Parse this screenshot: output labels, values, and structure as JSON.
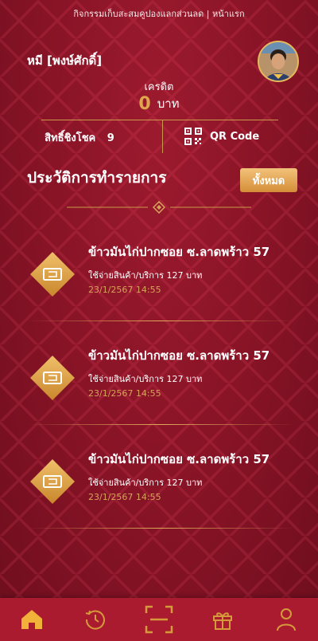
{
  "header": {
    "title": "กิจกรรมเก็บสะสมคูปองแลกส่วนลด | หน้าแรก"
  },
  "user": {
    "name": "หมี [พงษ์ศักดิ์]",
    "avatar_icon": "user-avatar-photo"
  },
  "credit": {
    "label": "เครดิต",
    "amount": "0",
    "unit": "บาท"
  },
  "chance": {
    "label": "สิทธิ์ชิงโชค",
    "value": "9"
  },
  "qr": {
    "label": "QR Code",
    "icon": "qr-code-icon"
  },
  "history": {
    "title": "ประวัติการทำรายการ",
    "all_label": "ทั้งหมด",
    "items": [
      {
        "shop": "ข้าวมันไก่ปากซอย ซ.ลาดพร้าว 57",
        "spend": "ใช้จ่ายสินค้า/บริการ 127 บาท",
        "time": "23/1/2567 14:55"
      },
      {
        "shop": "ข้าวมันไก่ปากซอย ซ.ลาดพร้าว 57",
        "spend": "ใช้จ่ายสินค้า/บริการ 127 บาท",
        "time": "23/1/2567 14:55"
      },
      {
        "shop": "ข้าวมันไก่ปากซอย ซ.ลาดพร้าว 57",
        "spend": "ใช้จ่ายสินค้า/บริการ 127 บาท",
        "time": "23/1/2567 14:55"
      }
    ]
  },
  "nav": {
    "items": [
      {
        "icon": "home-icon",
        "active": true
      },
      {
        "icon": "history-icon",
        "active": false
      },
      {
        "icon": "scan-icon",
        "active": false
      },
      {
        "icon": "gift-icon",
        "active": false
      },
      {
        "icon": "profile-icon",
        "active": false
      }
    ]
  },
  "colors": {
    "primary": "#8a1427",
    "gold": "#e0a64e",
    "nav_bg": "#aa1b30"
  }
}
